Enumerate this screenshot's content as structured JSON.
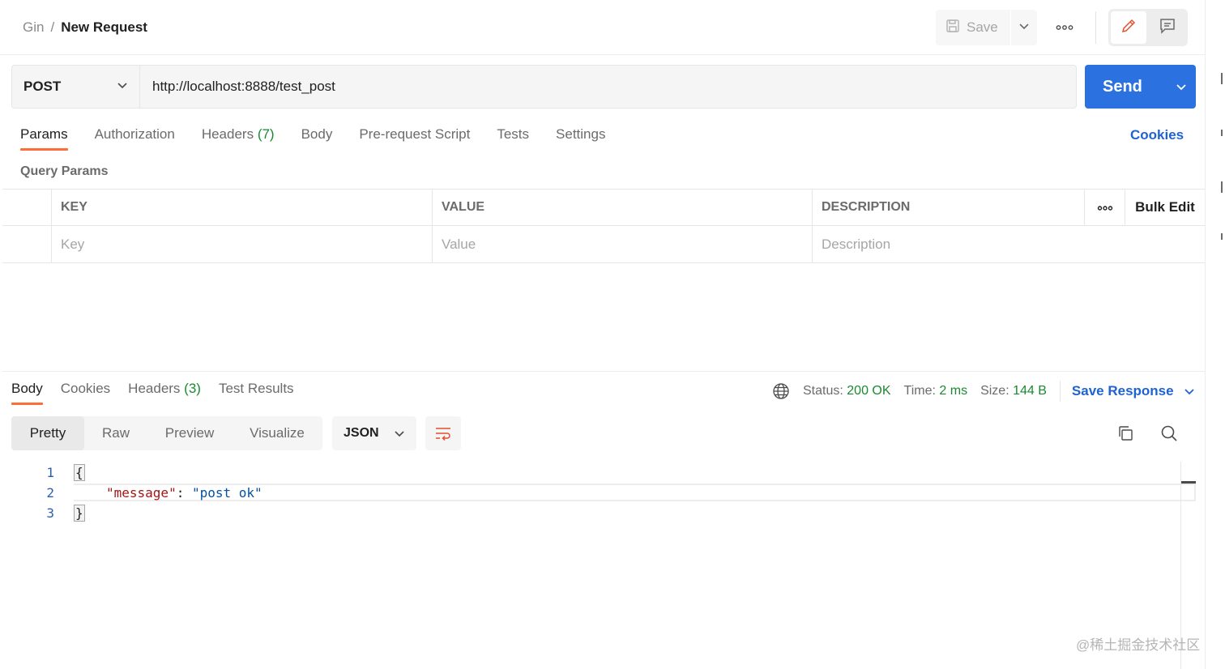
{
  "breadcrumb": {
    "parent": "Gin",
    "separator": "/",
    "current": "New Request"
  },
  "toolbar": {
    "save_label": "Save"
  },
  "request": {
    "method": "POST",
    "url": "http://localhost:8888/test_post",
    "send_label": "Send"
  },
  "request_tabs": [
    {
      "label": "Params",
      "active": true
    },
    {
      "label": "Authorization"
    },
    {
      "label": "Headers",
      "count": "(7)"
    },
    {
      "label": "Body"
    },
    {
      "label": "Pre-request Script"
    },
    {
      "label": "Tests"
    },
    {
      "label": "Settings"
    }
  ],
  "cookies_label": "Cookies",
  "query_params": {
    "title": "Query Params",
    "columns": [
      "KEY",
      "VALUE",
      "DESCRIPTION"
    ],
    "bulk_edit_label": "Bulk Edit",
    "placeholders": {
      "key": "Key",
      "value": "Value",
      "description": "Description"
    }
  },
  "response_tabs": [
    {
      "label": "Body",
      "active": true
    },
    {
      "label": "Cookies"
    },
    {
      "label": "Headers",
      "count": "(3)"
    },
    {
      "label": "Test Results"
    }
  ],
  "response_meta": {
    "status_label": "Status:",
    "status_value": "200 OK",
    "time_label": "Time:",
    "time_value": "2 ms",
    "size_label": "Size:",
    "size_value": "144 B",
    "save_response_label": "Save Response"
  },
  "format_tabs": [
    {
      "label": "Pretty",
      "active": true
    },
    {
      "label": "Raw"
    },
    {
      "label": "Preview"
    },
    {
      "label": "Visualize"
    }
  ],
  "language": "JSON",
  "code": {
    "line_numbers": [
      "1",
      "2",
      "3"
    ],
    "open_brace": "{",
    "key": "\"message\"",
    "colon": ": ",
    "value": "\"post ok\"",
    "close_brace": "}"
  },
  "watermark": "@稀土掘金技术社区",
  "colors": {
    "accent": "#ff6c37",
    "primary": "#2b72e0",
    "link": "#1f63d1",
    "success": "#198a2f"
  }
}
